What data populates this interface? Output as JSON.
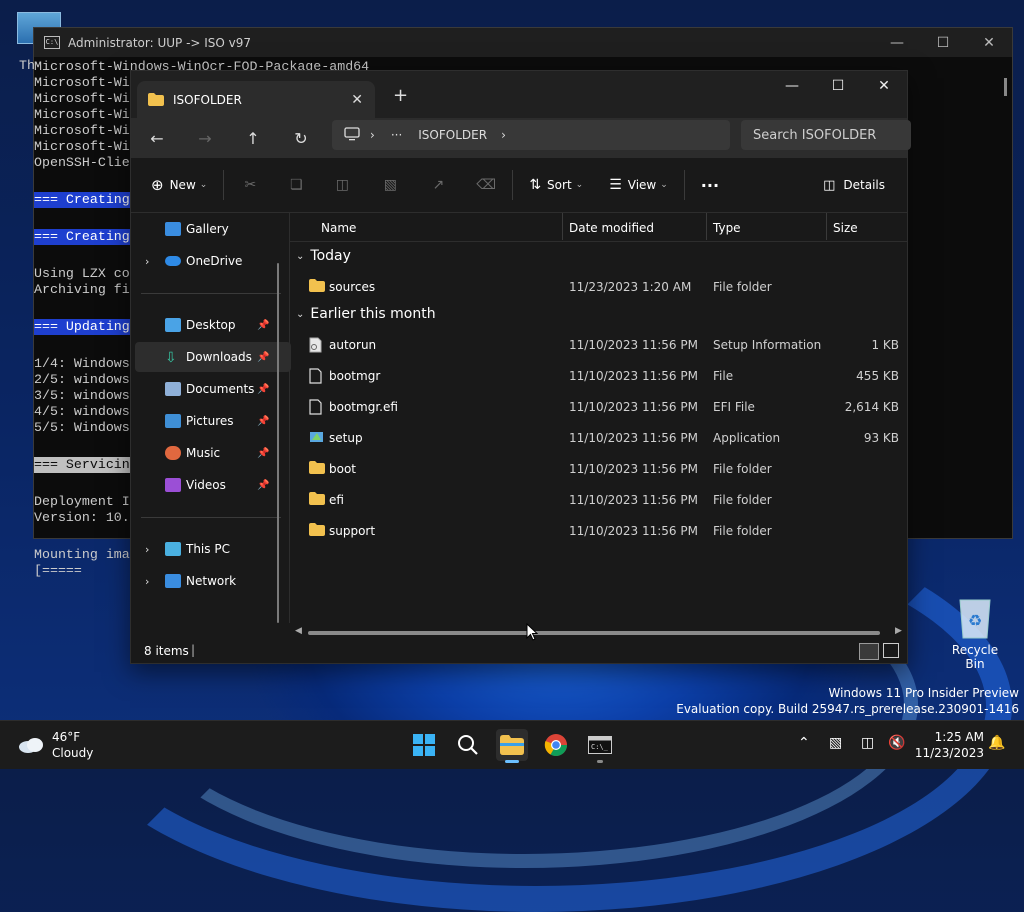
{
  "desktop": {
    "recycle_bin_label": "Recycle Bin",
    "watermark_line1": "Windows 11 Pro Insider Preview",
    "watermark_line2": "Evaluation copy. Build 25947.rs_prerelease.230901-1416"
  },
  "console": {
    "title": "Administrator: UUP -> ISO v97",
    "stub_prefix": "Th",
    "lines": [
      {
        "text": "Microsoft-Windows-WinOcr-FOD-Package-amd64",
        "style": ""
      },
      {
        "text": "Microsoft-Wi",
        "style": ""
      },
      {
        "text": "Microsoft-Wi",
        "style": ""
      },
      {
        "text": "Microsoft-Wi",
        "style": ""
      },
      {
        "text": "Microsoft-Wi",
        "style": ""
      },
      {
        "text": "Microsoft-Wi",
        "style": ""
      },
      {
        "text": "OpenSSH-Clie",
        "style": ""
      },
      {
        "text": "",
        "style": ""
      },
      {
        "text": "=== Creating",
        "style": "hl"
      },
      {
        "text": "",
        "style": ""
      },
      {
        "text": "=== Creating",
        "style": "hl"
      },
      {
        "text": "",
        "style": ""
      },
      {
        "text": "Using LZX co",
        "style": ""
      },
      {
        "text": "Archiving fi",
        "style": ""
      },
      {
        "text": "",
        "style": ""
      },
      {
        "text": "=== Updating",
        "style": "hl"
      },
      {
        "text": "",
        "style": ""
      },
      {
        "text": "1/4: Windows",
        "style": ""
      },
      {
        "text": "2/5: windows",
        "style": ""
      },
      {
        "text": "3/5: windows",
        "style": ""
      },
      {
        "text": "4/5: windows",
        "style": ""
      },
      {
        "text": "5/5: Windows",
        "style": ""
      },
      {
        "text": "",
        "style": ""
      },
      {
        "text": "=== Servicin",
        "style": "hl2"
      },
      {
        "text": "",
        "style": ""
      },
      {
        "text": "Deployment I",
        "style": ""
      },
      {
        "text": "Version: 10.",
        "style": ""
      },
      {
        "text": "",
        "style": ""
      },
      {
        "text": "Mounting ima",
        "style": ""
      },
      {
        "text": "[=====",
        "style": ""
      }
    ]
  },
  "explorer": {
    "tab_title": "ISOFOLDER",
    "address_segment": "ISOFOLDER",
    "address_more": "···",
    "search_placeholder": "Search ISOFOLDER",
    "toolbar": {
      "new_label": "New",
      "sort_label": "Sort",
      "view_label": "View",
      "more_label": "···",
      "details_label": "Details"
    },
    "sidebar": {
      "gallery": "Gallery",
      "onedrive": "OneDrive",
      "desktop": "Desktop",
      "downloads": "Downloads",
      "documents": "Documents",
      "pictures": "Pictures",
      "music": "Music",
      "videos": "Videos",
      "thispc": "This PC",
      "network": "Network"
    },
    "columns": {
      "name": "Name",
      "date": "Date modified",
      "type": "Type",
      "size": "Size"
    },
    "groups": {
      "today": "Today",
      "earlier": "Earlier this month"
    },
    "files": [
      {
        "name": "sources",
        "date": "11/23/2023 1:20 AM",
        "type": "File folder",
        "size": "",
        "icon": "folder-icon"
      },
      {
        "name": "autorun",
        "date": "11/10/2023 11:56 PM",
        "type": "Setup Information",
        "size": "1 KB",
        "icon": "setup-info-file-icon"
      },
      {
        "name": "bootmgr",
        "date": "11/10/2023 11:56 PM",
        "type": "File",
        "size": "455 KB",
        "icon": "file-icon"
      },
      {
        "name": "bootmgr.efi",
        "date": "11/10/2023 11:56 PM",
        "type": "EFI File",
        "size": "2,614 KB",
        "icon": "file-icon"
      },
      {
        "name": "setup",
        "date": "11/10/2023 11:56 PM",
        "type": "Application",
        "size": "93 KB",
        "icon": "setup-app-icon"
      },
      {
        "name": "boot",
        "date": "11/10/2023 11:56 PM",
        "type": "File folder",
        "size": "",
        "icon": "folder-icon"
      },
      {
        "name": "efi",
        "date": "11/10/2023 11:56 PM",
        "type": "File folder",
        "size": "",
        "icon": "folder-icon"
      },
      {
        "name": "support",
        "date": "11/10/2023 11:56 PM",
        "type": "File folder",
        "size": "",
        "icon": "folder-icon"
      }
    ],
    "status_text": "8 items"
  },
  "taskbar": {
    "temperature": "46°F",
    "condition": "Cloudy",
    "time": "1:25 AM",
    "date": "11/23/2023"
  },
  "colors": {
    "accent": "#1e3fcf",
    "folder": "#f2c14e",
    "explorer_bg": "#191919"
  }
}
